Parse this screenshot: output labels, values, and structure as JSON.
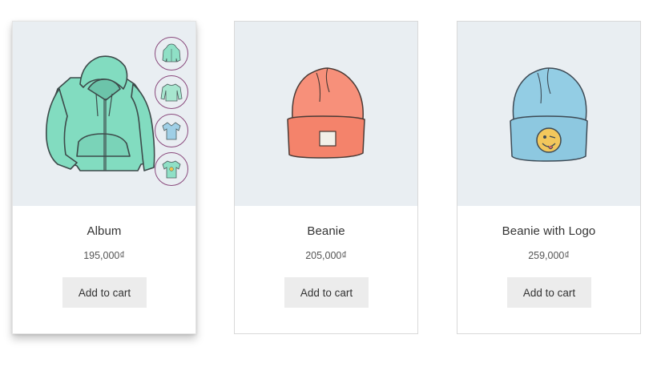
{
  "products": [
    {
      "title": "Album",
      "price": "195,000₫",
      "button_label": "Add to cart",
      "image_icon": "hoodie-image",
      "color": "#7fd9bd",
      "variations": [
        "hoodie-thumbnail",
        "long-sleeve-tee-thumbnail",
        "polo-thumbnail",
        "tshirt-thumbnail"
      ]
    },
    {
      "title": "Beanie",
      "price": "205,000₫",
      "button_label": "Add to cart",
      "image_icon": "orange-beanie-image",
      "color": "#f58c72"
    },
    {
      "title": "Beanie with Logo",
      "price": "259,000₫",
      "button_label": "Add to cart",
      "image_icon": "blue-beanie-with-logo-image",
      "color": "#8fcbe3"
    }
  ]
}
